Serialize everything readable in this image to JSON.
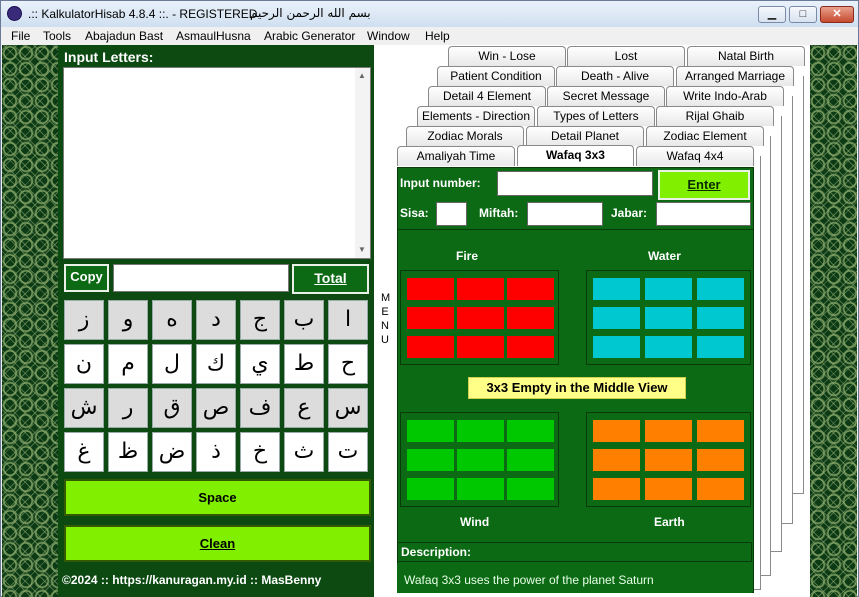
{
  "window": {
    "title": ".:: KalkulatorHisab 4.8.4 ::. - REGISTERED",
    "subtitle_arabic": "بسم الله الرحمن الرحيم",
    "minimize": "▁",
    "maximize": "□",
    "close": "✕"
  },
  "menu": [
    "File",
    "Tools",
    "Abajadun Bast",
    "AsmaulHusna",
    "Arabic Generator",
    "Window",
    "Help"
  ],
  "left": {
    "input_label": "Input Letters:",
    "copy_label": "Copy",
    "total_label": "Total",
    "keys": [
      [
        "ز",
        "و",
        "ه",
        "د",
        "ج",
        "ب",
        "ا"
      ],
      [
        "ن",
        "م",
        "ل",
        "ك",
        "ي",
        "ط",
        "ح"
      ],
      [
        "ش",
        "ر",
        "ق",
        "ص",
        "ف",
        "ع",
        "س"
      ],
      [
        "غ",
        "ظ",
        "ض",
        "ذ",
        "خ",
        "ث",
        "ت"
      ]
    ],
    "space_label": "Space",
    "clean_label": "Clean",
    "footer": "©2024 ::   https://kanuragan.my.id   ::  MasBenny"
  },
  "menu_vertical": "MENU",
  "tabs": {
    "row1": [
      "Win - Lose",
      "Lost",
      "Natal Birth"
    ],
    "row2": [
      "Patient Condition",
      "Death - Alive",
      "Arranged Marriage"
    ],
    "row3": [
      "Detail 4 Element",
      "Secret Message",
      "Write Indo-Arab"
    ],
    "row4": [
      "Elements - Direction",
      "Types of Letters",
      "Rijal Ghaib"
    ],
    "row5": [
      "Zodiac Morals",
      "Detail Planet",
      "Zodiac Element"
    ],
    "row6": [
      "Amaliyah Time",
      "Wafaq 3x3",
      "Wafaq 4x4"
    ],
    "active": "Wafaq 3x3"
  },
  "wafaq": {
    "input_number_label": "Input number:",
    "input_number_value": "",
    "enter_label": "Enter",
    "sisa_label": "Sisa:",
    "miftah_label": "Miftah:",
    "jabar_label": "Jabar:",
    "fire_label": "Fire",
    "water_label": "Water",
    "wind_label": "Wind",
    "earth_label": "Earth",
    "view_label": "3x3 Empty in the Middle View",
    "fire_color": "#ff0000",
    "water_color": "#00c8d0",
    "wind_color": "#00c800",
    "earth_color": "#ff8000",
    "description_label": "Description:",
    "description_text": "Wafaq 3x3 uses the power of the planet Saturn"
  }
}
